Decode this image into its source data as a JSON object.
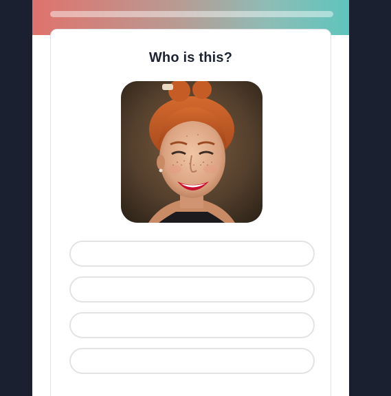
{
  "quiz": {
    "question": "Who is this?",
    "progress": 0,
    "portrait_icon": "photo-of-smiling-red-haired-woman",
    "options": [
      {
        "label": ""
      },
      {
        "label": ""
      },
      {
        "label": ""
      },
      {
        "label": ""
      }
    ]
  },
  "colors": {
    "background": "#1b2030",
    "gradient_start": "#e0726c",
    "gradient_end": "#5fc5bd",
    "option_border": "#e3e3e6",
    "text": "#1d2331"
  }
}
